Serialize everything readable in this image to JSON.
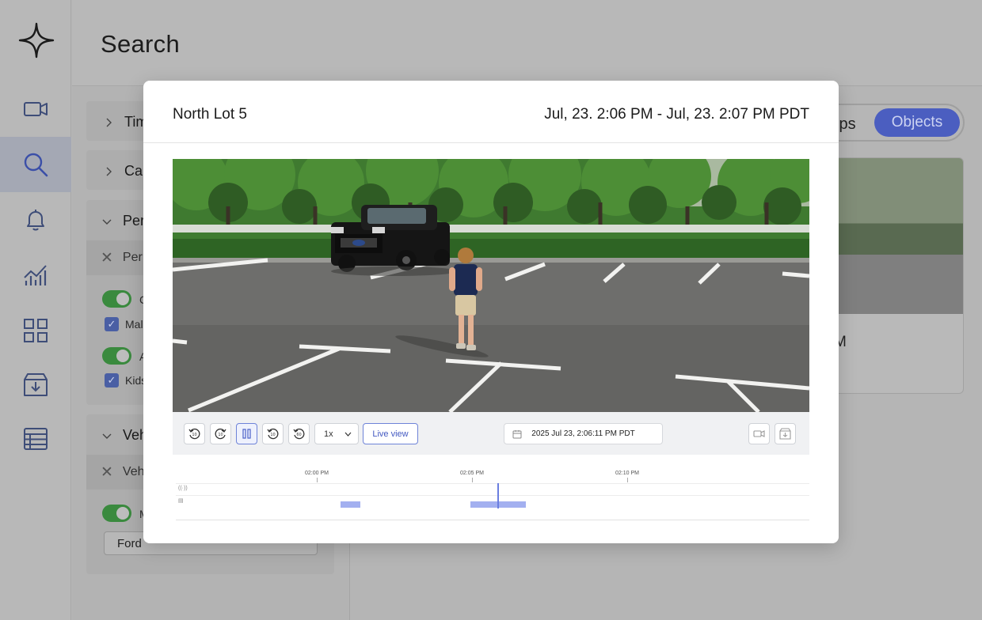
{
  "page": {
    "title": "Search"
  },
  "sidebar": {
    "items": [
      {
        "name": "video",
        "icon": "video-camera-icon",
        "active": false
      },
      {
        "name": "search",
        "icon": "search-icon",
        "active": true
      },
      {
        "name": "alerts",
        "icon": "bell-icon",
        "active": false
      },
      {
        "name": "analytics",
        "icon": "chart-icon",
        "active": false
      },
      {
        "name": "dashboards",
        "icon": "grid-icon",
        "active": false
      },
      {
        "name": "downloads",
        "icon": "download-box-icon",
        "active": false
      },
      {
        "name": "table",
        "icon": "table-icon",
        "active": false
      }
    ]
  },
  "filters": {
    "sections": [
      {
        "label": "Tim",
        "expanded": false
      },
      {
        "label": "Car",
        "expanded": false
      },
      {
        "label": "Per",
        "expanded": true
      },
      {
        "label": "Veh",
        "expanded": true
      }
    ],
    "person_chip": "Per",
    "person_options": [
      {
        "type": "toggle",
        "label": "C"
      },
      {
        "type": "check",
        "label": "Mal"
      },
      {
        "type": "toggle",
        "label": "A"
      },
      {
        "type": "check",
        "label": "Kids"
      }
    ],
    "vehicle_chip": "Veh",
    "vehicle_options": [
      {
        "type": "toggle",
        "label": "M"
      }
    ],
    "vehicle_make_value": "Ford"
  },
  "view_toggle": {
    "clips_label": "ips",
    "objects_label": "Objects",
    "selected": "Objects"
  },
  "background_card": {
    "caption": "M"
  },
  "modal": {
    "camera_name": "North Lot 5",
    "time_range": "Jul, 23. 2:06 PM - Jul, 23. 2:07 PM PDT",
    "controls": {
      "rewind_label": "10",
      "back_label": "10",
      "forward_label": "10",
      "fast_forward_label": "60",
      "speed": "1x",
      "live_view_label": "Live view",
      "timestamp": "2025 Jul 23, 2:06:11 PM PDT"
    },
    "timeline": {
      "ticks": [
        "02:00 PM",
        "02:05 PM",
        "02:10 PM"
      ],
      "row_icons": [
        "motion-icon",
        "clip-icon"
      ],
      "accent": "#a3b0f0",
      "cursor_color": "#6a7ee0"
    }
  },
  "colors": {
    "accent": "#4b5ec0",
    "toggle_on": "#3a8a3e",
    "overlay_bg": "#b5b5b5"
  }
}
